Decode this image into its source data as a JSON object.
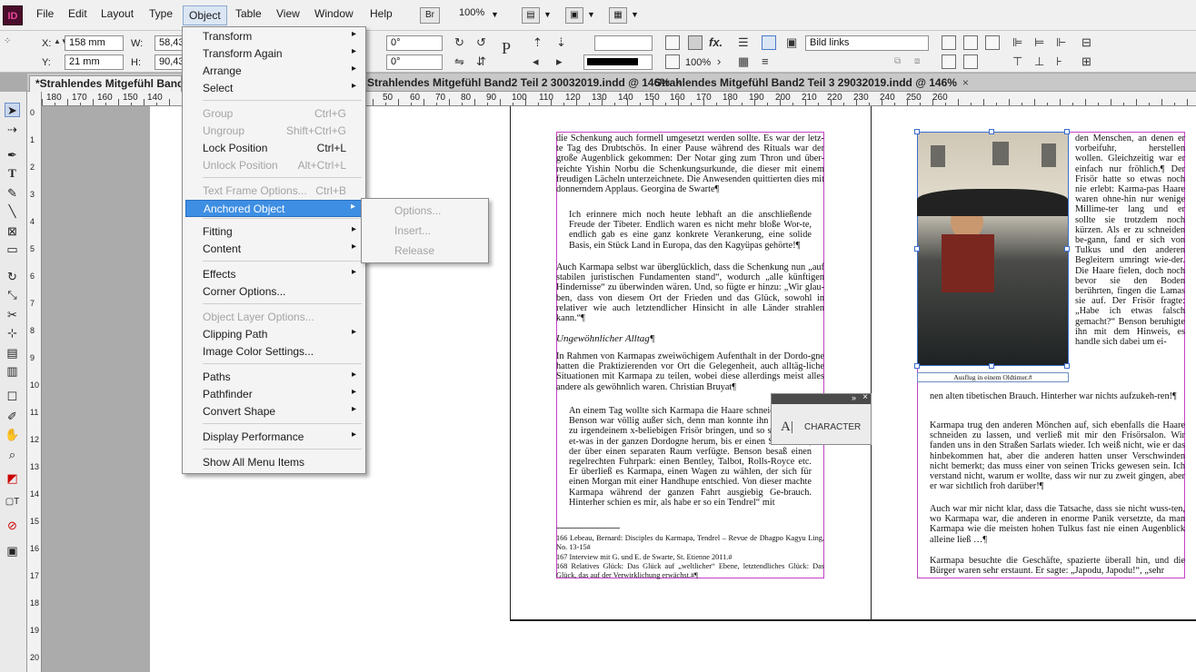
{
  "menubar": {
    "logo": "ID",
    "items": [
      "File",
      "Edit",
      "Layout",
      "Type",
      "Object",
      "Table",
      "View",
      "Window",
      "Help"
    ],
    "bridge": "Br",
    "zoom": "100%"
  },
  "control": {
    "x_label": "X:",
    "x_value": "158 mm",
    "y_label": "Y:",
    "y_value": "21 mm",
    "w_label": "W:",
    "w_value": "58,432",
    "h_label": "H:",
    "h_value": "90,439",
    "rotation": "0°",
    "shear": "0°",
    "scale": "100%",
    "object_style": "Bild links"
  },
  "tabs": [
    {
      "label": "*Strahlendes Mitgefühl Band2 T",
      "close": ""
    },
    {
      "label": "Strahlendes Mitgefühl Band2 Teil 2 30032019.indd @ 146%",
      "close": "×"
    },
    {
      "label": "Strahlendes Mitgefühl Band2 Teil 3 29032019.indd @ 146%",
      "close": "×"
    }
  ],
  "ruler": {
    "top": [
      "180",
      "170",
      "160",
      "150",
      "140",
      "50",
      "60",
      "70",
      "80",
      "90",
      "100",
      "110",
      "120",
      "130",
      "140",
      "150",
      "160",
      "170",
      "180",
      "190",
      "200",
      "210",
      "220",
      "230",
      "240",
      "250",
      "260"
    ],
    "left": [
      "0",
      "1",
      "2",
      "3",
      "4",
      "5",
      "6",
      "7",
      "8",
      "9",
      "10",
      "11",
      "12",
      "13",
      "14",
      "15",
      "16",
      "17",
      "18",
      "19",
      "20"
    ]
  },
  "object_menu": {
    "items": [
      {
        "label": "Transform",
        "sub": true
      },
      {
        "label": "Transform Again",
        "sub": true
      },
      {
        "label": "Arrange",
        "sub": true
      },
      {
        "label": "Select",
        "sub": true
      },
      {
        "label": "Group",
        "shortcut": "Ctrl+G",
        "disabled": true
      },
      {
        "label": "Ungroup",
        "shortcut": "Shift+Ctrl+G",
        "disabled": true
      },
      {
        "label": "Lock Position",
        "shortcut": "Ctrl+L"
      },
      {
        "label": "Unlock Position",
        "shortcut": "Alt+Ctrl+L",
        "disabled": true
      },
      {
        "label": "Text Frame Options...",
        "shortcut": "Ctrl+B",
        "disabled": true
      },
      {
        "label": "Anchored Object",
        "sub": true,
        "highlighted": true
      },
      {
        "label": "Fitting",
        "sub": true
      },
      {
        "label": "Content",
        "sub": true
      },
      {
        "label": "Effects",
        "sub": true
      },
      {
        "label": "Corner Options..."
      },
      {
        "label": "Object Layer Options...",
        "disabled": true
      },
      {
        "label": "Clipping Path",
        "sub": true
      },
      {
        "label": "Image Color Settings..."
      },
      {
        "label": "Paths",
        "sub": true
      },
      {
        "label": "Pathfinder",
        "sub": true
      },
      {
        "label": "Convert Shape",
        "sub": true
      },
      {
        "label": "Display Performance",
        "sub": true
      },
      {
        "label": "Show All Menu Items"
      }
    ]
  },
  "anchored_submenu": {
    "items": [
      "Options...",
      "Insert...",
      "Release"
    ]
  },
  "character_panel": {
    "label": "CHARACTER"
  },
  "page_left": {
    "p1": "die Schenkung auch formell umgesetzt werden sollte. Es war der letz-te Tag des Drubtschös. In einer Pause während des Rituals war der große Augenblick gekommen: Der Notar ging zum Thron und über-reichte Yishin Norbu die Schenkungsurkunde, die dieser mit einem freudigen Lächeln unterzeichnete. Die Anwesenden quittierten dies mit donnerndem Applaus. Georgina de Swarte¶",
    "p2": "Ich erinnere mich noch heute lebhaft an die anschließende Freude der Tibeter. Endlich waren es nicht mehr bloße Wor-te, endlich gab es eine ganz konkrete Verankerung, eine solide Basis, ein Stück Land in Europa, das den Kagyüpas gehörte!¶",
    "p3": "Auch Karmapa selbst war überglücklich, dass die Schenkung nun „auf stabilen juristischen Fundamenten stand“, wodurch „alle künftigen Hindernisse“ zu überwinden wären. Und, so fügte er hinzu: „Wir glau-ben, dass von diesem Ort der Frieden und das Glück, sowohl in relativer wie auch letztendlicher Hinsicht in alle Länder strahlen kann.“¶",
    "heading": "Ungewöhnlicher Alltag¶",
    "p4": "In Rahmen von Karmapas zweiwöchigem Aufenthalt in der Dordo-gne hatten die Praktizierenden vor Ort die Gelegenheit, auch alltäg-liche Situationen mit Karmapa zu teilen, wobei diese allerdings meist alles andere als gewöhnlich waren. Christian Bruyat¶",
    "p5": "An einem Tag wollte sich Karmapa die Haare schneiden lassen. Benson war völlig außer sich, denn man konnte ihn doch nicht zu irgendeinem x-beliebigen Frisör bringen, und so suchten wir et-was in der ganzen Dordogne herum, bis er einen Salon fand, der über einen separaten Raum verfügte. Benson besaß einen regelrechten Fuhrpark: einen Bentley, Talbot, Rolls-Royce etc. Er überließ es Karmapa, einen Wagen zu wählen, der sich für einen Morgan mit einer Handhupe entschied. Von dieser machte Karmapa während der ganzen Fahrt ausgiebig Ge-brauch. Hinterher schien es mir, als habe er so ein Tendrel“ mit",
    "fn1": "166 Lebeau, Bernard: Disciples du Karmapa, Tendrel – Revue de Dhagpo Kagyu Ling, No. 13-15#",
    "fn2": "167 Interview mit G. und E. de Swarte, St. Etienne 2011.#",
    "fn3": "168 Relatives Glück: Das Glück auf „weltlicher“ Ebene, letztendliches Glück: Das Glück, das auf der Verwirklichung erwächst.#¶"
  },
  "page_right": {
    "col": "den Menschen, an denen er vorbeifuhr, herstellen wollen. Gleichzeitig war er einfach nur fröhlich.¶ Der Frisör hatte so etwas noch nie erlebt: Karma-pas Haare waren ohne-hin nur wenige Millime-ter lang und er sollte sie trotzdem noch kürzen. Als er zu schneiden be-gann, fand er sich von Tulkus und den anderen Begleitern umringt wie-der. Die Haare fielen, doch noch bevor sie den Boden berührten, fingen die Lamas sie auf. Der Frisör fragte: „Habe ich etwas falsch gemacht?“ Benson beruhigte ihn mit dem Hinweis, es handle sich dabei um ei-",
    "caption": "Ausflug in einem Oldtimer.#",
    "p1": "nen alten tibetischen Brauch. Hinterher war nichts aufzukeh-ren!¶",
    "p2": "Karmapa trug den anderen Mönchen auf, sich ebenfalls die Haare schneiden zu lassen, und verließ mit mir den Frisörsalon. Wir fanden uns in den Straßen Sarlats wieder. Ich weiß nicht, wie er das hinbekommen hat, aber die anderen hatten unser Verschwinden nicht bemerkt; das muss einer von seinen Tricks gewesen sein. Ich verstand nicht, warum er wollte, dass wir nur zu zweit gingen, aber er war sichtlich froh darüber!¶",
    "p3": "Auch war mir nicht klar, dass die Tatsache, dass sie nicht wuss-ten, wo Karmapa war, die anderen in enorme Panik versetzte, da man Karmapa wie die meisten hohen Tulkus fast nie einen Augenblick alleine ließ …¶",
    "p4": "Karmapa besuchte die Geschäfte, spazierte überall hin, und die Bürger waren sehr erstaunt. Er sagte: „Japodu, Japodu!“, „sehr"
  }
}
